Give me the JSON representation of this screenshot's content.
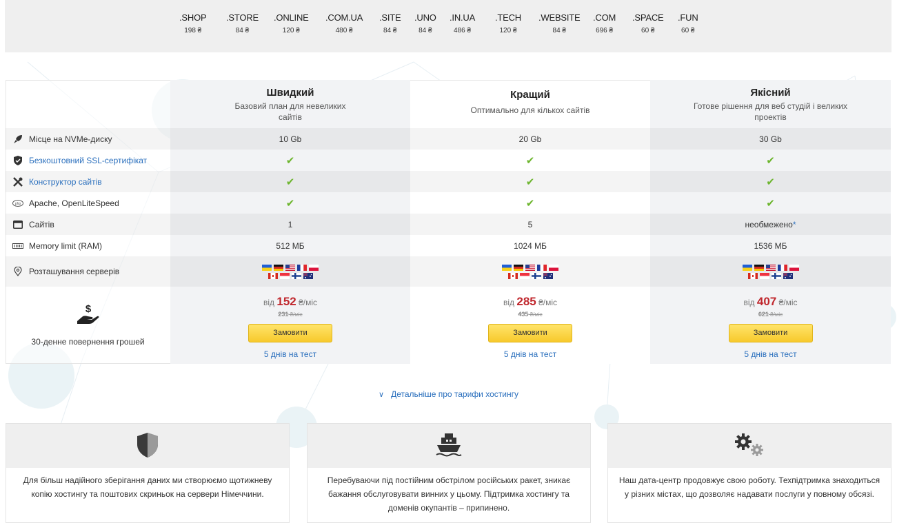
{
  "domains": [
    {
      "zone": ".SHOP",
      "price": "198 ₴"
    },
    {
      "zone": ".STORE",
      "price": "84 ₴"
    },
    {
      "zone": ".ONLINE",
      "price": "120 ₴"
    },
    {
      "zone": ".COM.UA",
      "price": "480 ₴"
    },
    {
      "zone": ".SITE",
      "price": "84 ₴"
    },
    {
      "zone": ".UNO",
      "price": "84 ₴"
    },
    {
      "zone": ".IN.UA",
      "price": "486 ₴"
    },
    {
      "zone": ".TECH",
      "price": "120 ₴"
    },
    {
      "zone": ".WEBSITE",
      "price": "84 ₴"
    },
    {
      "zone": ".COM",
      "price": "696 ₴"
    },
    {
      "zone": ".SPACE",
      "price": "60 ₴"
    },
    {
      "zone": ".FUN",
      "price": "60 ₴"
    }
  ],
  "plans": [
    {
      "name": "Швидкий",
      "description": "Базовий план для невеликих сайтів",
      "disk": "10 Gb",
      "sites": "1",
      "ram": "512 МБ",
      "price_prefix": "від",
      "price": "152",
      "price_unit": "₴/міс",
      "old_price": "231",
      "old_unit": "₴/міс",
      "order_label": "Замовити",
      "test_label": "5 днів на тест"
    },
    {
      "name": "Кращий",
      "description": "Оптимально для кількох сайтів",
      "disk": "20 Gb",
      "sites": "5",
      "ram": "1024 МБ",
      "price_prefix": "від",
      "price": "285",
      "price_unit": "₴/міс",
      "old_price": "435",
      "old_unit": "₴/міс",
      "order_label": "Замовити",
      "test_label": "5 днів на тест"
    },
    {
      "name": "Якісний",
      "description": "Готове рішення для веб студій і великих проектів",
      "disk": "30 Gb",
      "sites": "необмежено",
      "sites_star": "*",
      "ram": "1536 МБ",
      "price_prefix": "від",
      "price": "407",
      "price_unit": "₴/міс",
      "old_price": "621",
      "old_unit": "₴/міс",
      "order_label": "Замовити",
      "test_label": "5 днів на тест"
    }
  ],
  "features": {
    "disk": {
      "label": "Місце на NVMe-диску",
      "icon": "rocket-icon"
    },
    "ssl": {
      "label": "Безкоштовний SSL-сертифікат",
      "icon": "shield-check-icon"
    },
    "builder": {
      "label": "Конструктор сайтів",
      "icon": "tools-icon"
    },
    "server": {
      "label": "Apache, OpenLiteSpeed",
      "icon": "php-icon"
    },
    "sites": {
      "label": "Сайтів",
      "icon": "browser-window-icon"
    },
    "ram": {
      "label": "Memory limit (RAM)",
      "icon": "memory-icon"
    },
    "location": {
      "label": "Розташування серверів",
      "icon": "location-pin-icon"
    }
  },
  "check_glyph": "✔",
  "flags_row1": [
    "ua",
    "de",
    "us",
    "fr",
    "pl"
  ],
  "flags_row2": [
    "ca",
    "sg",
    "fi",
    "au"
  ],
  "moneyback": {
    "label": "30-денне повернення грошей",
    "icon": "money-hand-icon"
  },
  "details_link": "Детальніше про тарифи хостингу",
  "cards": [
    {
      "icon": "shield-icon",
      "text": "Для більш надійного зберігання даних ми створюємо щотижневу копію хостингу та поштових скриньок на сервери Німеччини."
    },
    {
      "icon": "ship-icon",
      "text": "Перебуваючи під постійним обстрілом російських ракет, зникає бажання обслуговувати винних у цьому. Підтримка хостингу та доменів окупантів – припинено."
    },
    {
      "icon": "gears-icon",
      "text": "Наш дата-центр продовжує свою роботу. Техпідтримка знаходиться у різних містах, що дозволяє надавати послуги у повному обсязі."
    }
  ],
  "colors": {
    "accent_blue": "#2a6fbd",
    "price_red": "#c0272d",
    "check_green": "#6cb52d",
    "button_yellow": "#f7c92c"
  }
}
